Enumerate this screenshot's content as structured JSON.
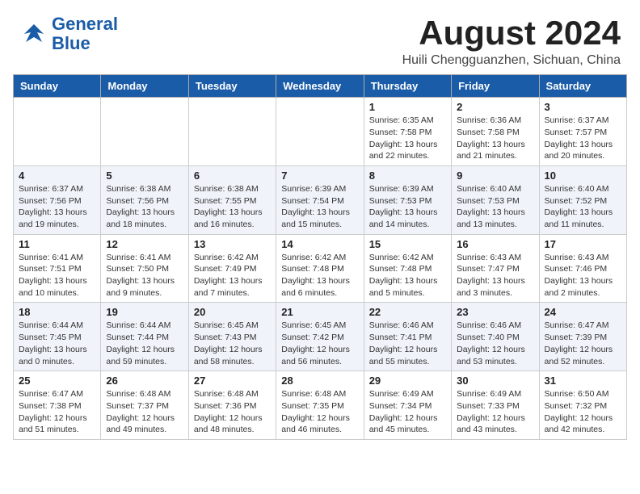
{
  "header": {
    "logo_line1": "General",
    "logo_line2": "Blue",
    "month_year": "August 2024",
    "location": "Huili Chengguanzhen, Sichuan, China"
  },
  "days_of_week": [
    "Sunday",
    "Monday",
    "Tuesday",
    "Wednesday",
    "Thursday",
    "Friday",
    "Saturday"
  ],
  "weeks": [
    [
      {
        "day": "",
        "info": ""
      },
      {
        "day": "",
        "info": ""
      },
      {
        "day": "",
        "info": ""
      },
      {
        "day": "",
        "info": ""
      },
      {
        "day": "1",
        "info": "Sunrise: 6:35 AM\nSunset: 7:58 PM\nDaylight: 13 hours and 22 minutes."
      },
      {
        "day": "2",
        "info": "Sunrise: 6:36 AM\nSunset: 7:58 PM\nDaylight: 13 hours and 21 minutes."
      },
      {
        "day": "3",
        "info": "Sunrise: 6:37 AM\nSunset: 7:57 PM\nDaylight: 13 hours and 20 minutes."
      }
    ],
    [
      {
        "day": "4",
        "info": "Sunrise: 6:37 AM\nSunset: 7:56 PM\nDaylight: 13 hours and 19 minutes."
      },
      {
        "day": "5",
        "info": "Sunrise: 6:38 AM\nSunset: 7:56 PM\nDaylight: 13 hours and 18 minutes."
      },
      {
        "day": "6",
        "info": "Sunrise: 6:38 AM\nSunset: 7:55 PM\nDaylight: 13 hours and 16 minutes."
      },
      {
        "day": "7",
        "info": "Sunrise: 6:39 AM\nSunset: 7:54 PM\nDaylight: 13 hours and 15 minutes."
      },
      {
        "day": "8",
        "info": "Sunrise: 6:39 AM\nSunset: 7:53 PM\nDaylight: 13 hours and 14 minutes."
      },
      {
        "day": "9",
        "info": "Sunrise: 6:40 AM\nSunset: 7:53 PM\nDaylight: 13 hours and 13 minutes."
      },
      {
        "day": "10",
        "info": "Sunrise: 6:40 AM\nSunset: 7:52 PM\nDaylight: 13 hours and 11 minutes."
      }
    ],
    [
      {
        "day": "11",
        "info": "Sunrise: 6:41 AM\nSunset: 7:51 PM\nDaylight: 13 hours and 10 minutes."
      },
      {
        "day": "12",
        "info": "Sunrise: 6:41 AM\nSunset: 7:50 PM\nDaylight: 13 hours and 9 minutes."
      },
      {
        "day": "13",
        "info": "Sunrise: 6:42 AM\nSunset: 7:49 PM\nDaylight: 13 hours and 7 minutes."
      },
      {
        "day": "14",
        "info": "Sunrise: 6:42 AM\nSunset: 7:48 PM\nDaylight: 13 hours and 6 minutes."
      },
      {
        "day": "15",
        "info": "Sunrise: 6:42 AM\nSunset: 7:48 PM\nDaylight: 13 hours and 5 minutes."
      },
      {
        "day": "16",
        "info": "Sunrise: 6:43 AM\nSunset: 7:47 PM\nDaylight: 13 hours and 3 minutes."
      },
      {
        "day": "17",
        "info": "Sunrise: 6:43 AM\nSunset: 7:46 PM\nDaylight: 13 hours and 2 minutes."
      }
    ],
    [
      {
        "day": "18",
        "info": "Sunrise: 6:44 AM\nSunset: 7:45 PM\nDaylight: 13 hours and 0 minutes."
      },
      {
        "day": "19",
        "info": "Sunrise: 6:44 AM\nSunset: 7:44 PM\nDaylight: 12 hours and 59 minutes."
      },
      {
        "day": "20",
        "info": "Sunrise: 6:45 AM\nSunset: 7:43 PM\nDaylight: 12 hours and 58 minutes."
      },
      {
        "day": "21",
        "info": "Sunrise: 6:45 AM\nSunset: 7:42 PM\nDaylight: 12 hours and 56 minutes."
      },
      {
        "day": "22",
        "info": "Sunrise: 6:46 AM\nSunset: 7:41 PM\nDaylight: 12 hours and 55 minutes."
      },
      {
        "day": "23",
        "info": "Sunrise: 6:46 AM\nSunset: 7:40 PM\nDaylight: 12 hours and 53 minutes."
      },
      {
        "day": "24",
        "info": "Sunrise: 6:47 AM\nSunset: 7:39 PM\nDaylight: 12 hours and 52 minutes."
      }
    ],
    [
      {
        "day": "25",
        "info": "Sunrise: 6:47 AM\nSunset: 7:38 PM\nDaylight: 12 hours and 51 minutes."
      },
      {
        "day": "26",
        "info": "Sunrise: 6:48 AM\nSunset: 7:37 PM\nDaylight: 12 hours and 49 minutes."
      },
      {
        "day": "27",
        "info": "Sunrise: 6:48 AM\nSunset: 7:36 PM\nDaylight: 12 hours and 48 minutes."
      },
      {
        "day": "28",
        "info": "Sunrise: 6:48 AM\nSunset: 7:35 PM\nDaylight: 12 hours and 46 minutes."
      },
      {
        "day": "29",
        "info": "Sunrise: 6:49 AM\nSunset: 7:34 PM\nDaylight: 12 hours and 45 minutes."
      },
      {
        "day": "30",
        "info": "Sunrise: 6:49 AM\nSunset: 7:33 PM\nDaylight: 12 hours and 43 minutes."
      },
      {
        "day": "31",
        "info": "Sunrise: 6:50 AM\nSunset: 7:32 PM\nDaylight: 12 hours and 42 minutes."
      }
    ]
  ]
}
